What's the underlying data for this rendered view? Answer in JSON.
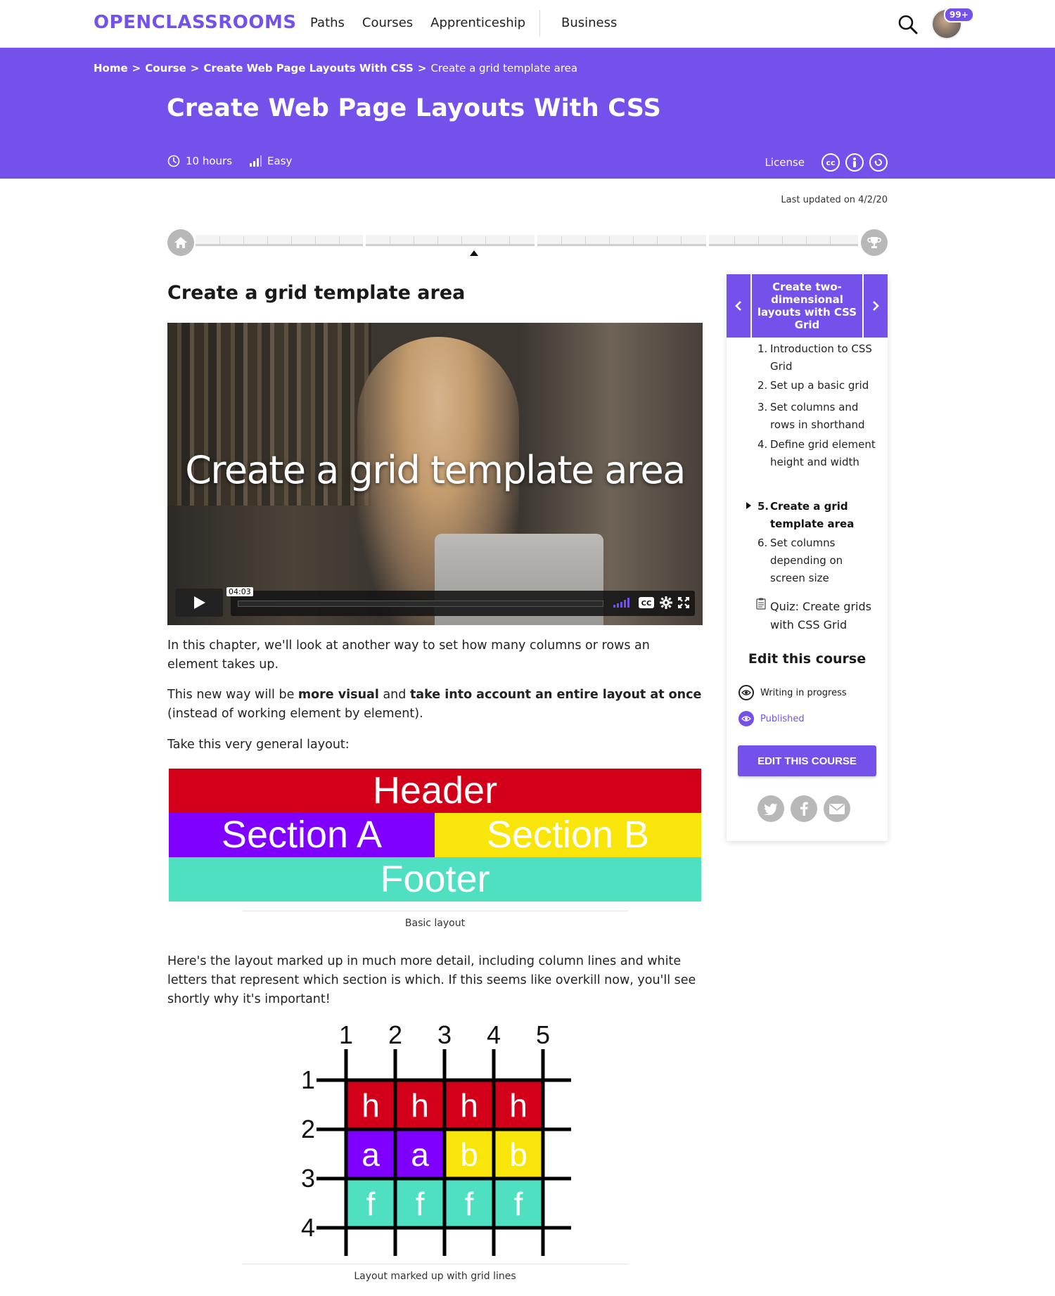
{
  "nav": {
    "logo": "OPENCLASSROOMS",
    "links": [
      "Paths",
      "Courses",
      "Apprenticeship"
    ],
    "business": "Business",
    "notification_count": "99+"
  },
  "hero": {
    "breadcrumb": [
      "Home",
      "Course",
      "Create Web Page Layouts With CSS"
    ],
    "breadcrumb_sep": ">",
    "breadcrumb_current": "Create a grid template area",
    "title": "Create Web Page Layouts With CSS",
    "duration": "10 hours",
    "level": "Easy",
    "license_label": "License",
    "license_icons": [
      "cc-icon",
      "by-icon",
      "sa-icon"
    ]
  },
  "updated": "Last updated on 4/2/20",
  "chapter": {
    "title": "Create a grid template area",
    "video_title": "Create a grid template area",
    "video_time": "04:03"
  },
  "content": {
    "p1": "In this chapter, we'll look at another way to set how many columns or rows an element takes up.",
    "p2_a": "This new way will be ",
    "p2_b": "more visual",
    "p2_c": " and ",
    "p2_d": "take into account an entire layout at once",
    "p2_e": " (instead of working element by element).",
    "p3": "Take this very general layout:",
    "layout": {
      "header": "Header",
      "section_a": "Section A",
      "section_b": "Section B",
      "footer": "Footer"
    },
    "caption1": "Basic layout",
    "p4": "Here's the layout marked up in much more detail, including column lines and white letters that represent which section is which. If this seems like overkill now, you'll see shortly why it's important!",
    "caption2": "Layout marked up with grid lines",
    "grid": {
      "col_labels": [
        "1",
        "2",
        "3",
        "4",
        "5"
      ],
      "row_labels": [
        "1",
        "2",
        "3",
        "4"
      ],
      "cells": [
        [
          "h",
          "h",
          "h",
          "h"
        ],
        [
          "a",
          "a",
          "b",
          "b"
        ],
        [
          "f",
          "f",
          "f",
          "f"
        ]
      ],
      "colors": {
        "h": "#d20019",
        "a": "#8000ff",
        "b": "#f8e50a",
        "f": "#4fe0c2"
      }
    }
  },
  "sidebar": {
    "part_title": "Create two-dimensional layouts with CSS Grid",
    "items": [
      {
        "num": "1.",
        "label": "Introduction to CSS Grid"
      },
      {
        "num": "2.",
        "label": "Set up a basic grid"
      },
      {
        "num": "3.",
        "label": "Set columns and rows in shorthand"
      },
      {
        "num": "4.",
        "label": "Define grid element height and width"
      },
      {
        "num": "5.",
        "label": "Create a grid template area"
      },
      {
        "num": "6.",
        "label": "Set columns depending on screen size"
      }
    ],
    "quiz": "Quiz: Create grids with CSS Grid",
    "edit_title": "Edit this course",
    "status_writing": "Writing in progress",
    "status_published": "Published",
    "edit_button": "EDIT THIS COURSE"
  },
  "colors": {
    "brand": "#7451eb"
  }
}
